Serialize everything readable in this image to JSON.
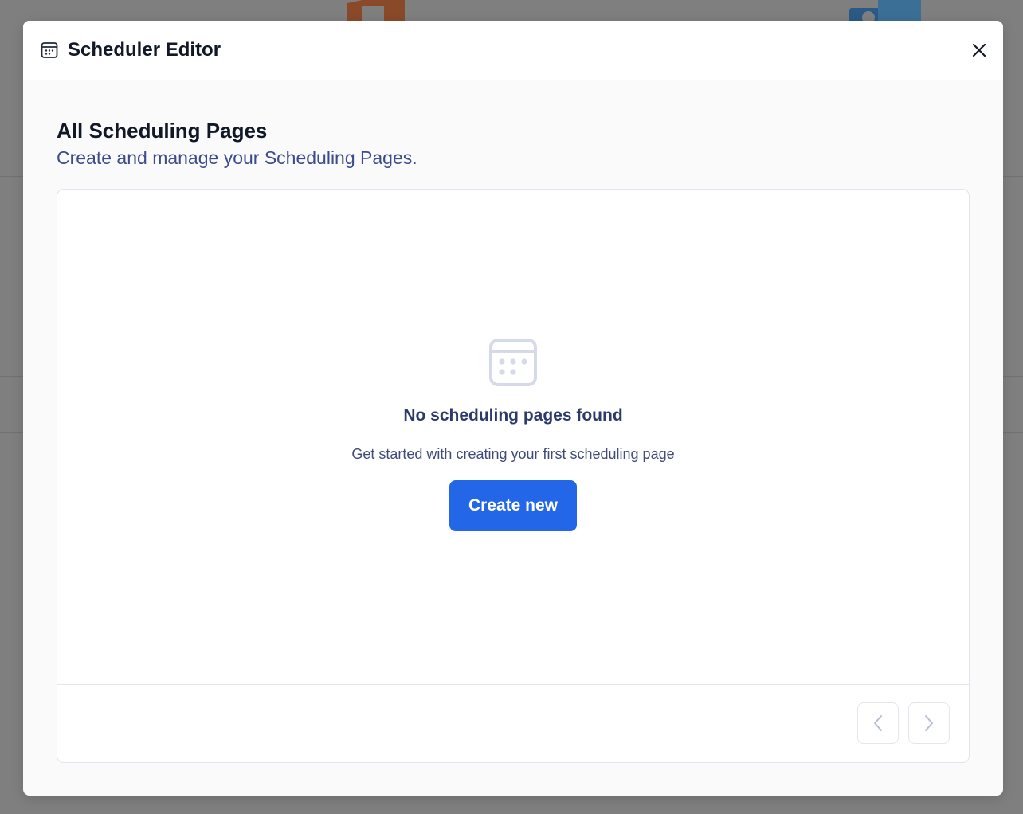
{
  "colors": {
    "primary": "#2466e8",
    "overlay": "#7f7f7f",
    "subtitle": "#3b4b8c",
    "icon_muted": "#d5d9e8"
  },
  "modal": {
    "header_icon": "calendar-icon",
    "title": "Scheduler Editor",
    "close_icon": "close-icon"
  },
  "section": {
    "title": "All Scheduling Pages",
    "subtitle": "Create and manage your Scheduling Pages."
  },
  "empty_state": {
    "icon": "calendar-icon",
    "title": "No scheduling pages found",
    "description": "Get started with creating your first scheduling page",
    "button_label": "Create new"
  },
  "pagination": {
    "prev_icon": "chevron-left-icon",
    "next_icon": "chevron-right-icon"
  }
}
